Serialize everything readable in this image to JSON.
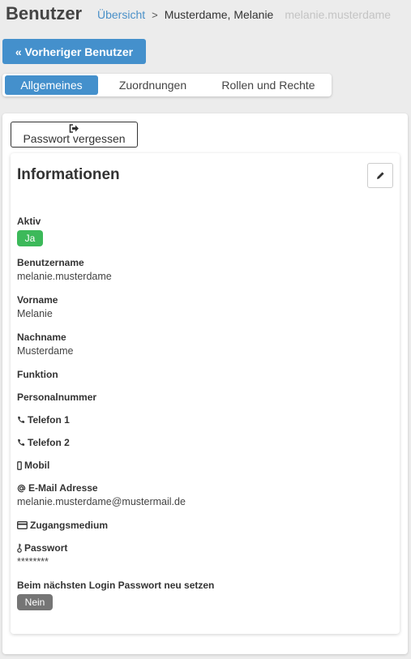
{
  "header": {
    "title": "Benutzer",
    "breadcrumb": {
      "link": "Übersicht",
      "separator": ">",
      "current": "Musterdame, Melanie",
      "sub": "melanie.musterdame"
    }
  },
  "actions": {
    "prev_user_label": "« Vorheriger Benutzer",
    "forgot_password_label": "Passwort vergessen"
  },
  "tabs": [
    {
      "label": "Allgemeines",
      "active": true
    },
    {
      "label": "Zuordnungen",
      "active": false
    },
    {
      "label": "Rollen und Rechte",
      "active": false
    }
  ],
  "info": {
    "title": "Informationen",
    "aktiv": {
      "label": "Aktiv",
      "value": "Ja"
    },
    "benutzername": {
      "label": "Benutzername",
      "value": "melanie.musterdame"
    },
    "vorname": {
      "label": "Vorname",
      "value": "Melanie"
    },
    "nachname": {
      "label": "Nachname",
      "value": "Musterdame"
    },
    "funktion": {
      "label": "Funktion"
    },
    "personalnummer": {
      "label": "Personalnummer"
    },
    "telefon1": {
      "label": "Telefon 1",
      "icon": "phone-icon"
    },
    "telefon2": {
      "label": "Telefon 2",
      "icon": "phone-icon"
    },
    "mobil": {
      "label": "Mobil",
      "icon": "mobile-icon"
    },
    "email": {
      "label": "E-Mail Adresse",
      "icon": "at-icon",
      "value": "melanie.musterdame@mustermail.de"
    },
    "zugangsmedium": {
      "label": "Zugangsmedium",
      "icon": "credit-card-icon"
    },
    "passwort": {
      "label": "Passwort",
      "icon": "key-icon",
      "value": "********"
    },
    "reset_login": {
      "label": "Beim nächsten Login Passwort neu setzen",
      "value": "Nein"
    }
  },
  "colors": {
    "primary": "#4490cc",
    "success": "#3cb95a",
    "muted_badge": "#757575",
    "link": "#4a90c8",
    "background": "#ececec"
  }
}
